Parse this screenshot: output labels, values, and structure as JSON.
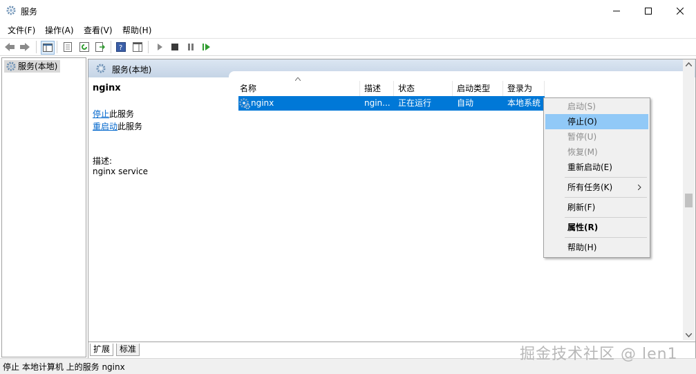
{
  "window": {
    "title": "服务"
  },
  "menu": {
    "items": [
      "文件(F)",
      "操作(A)",
      "查看(V)",
      "帮助(H)"
    ]
  },
  "tree": {
    "item_label": "服务(本地)"
  },
  "main": {
    "header_title": "服务(本地)",
    "detail": {
      "service_name": "nginx",
      "stop_link": "停止",
      "stop_suffix": "此服务",
      "restart_link": "重启动",
      "restart_suffix": "此服务",
      "desc_label": "描述:",
      "desc_text": "nginx service"
    },
    "columns": [
      "名称",
      "描述",
      "状态",
      "启动类型",
      "登录为"
    ],
    "rows": [
      {
        "name": "nginx",
        "desc": "ngin...",
        "status": "正在运行",
        "startup": "自动",
        "logon": "本地系统"
      }
    ],
    "tabs": [
      "扩展",
      "标准"
    ]
  },
  "context_menu": {
    "start": "启动(S)",
    "stop": "停止(O)",
    "pause": "暂停(U)",
    "resume": "恢复(M)",
    "restart": "重新启动(E)",
    "all_tasks": "所有任务(K)",
    "refresh": "刷新(F)",
    "properties": "属性(R)",
    "help": "帮助(H)"
  },
  "status_bar": {
    "text": "停止 本地计算机 上的服务 nginx"
  },
  "watermark": "掘金技术社区 @ len1",
  "colors": {
    "selection": "#0078d7",
    "menu_highlight": "#91c9f7",
    "header": "#c5d4e6"
  }
}
